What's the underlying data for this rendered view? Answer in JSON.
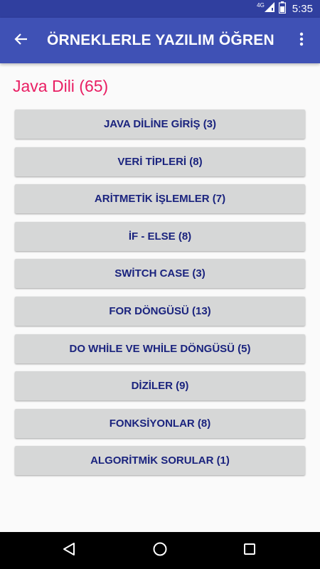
{
  "status_bar": {
    "network_label": "4G",
    "time": "5:35",
    "icons": [
      "signal-icon",
      "battery-icon"
    ]
  },
  "app_bar": {
    "title": "ÖRNEKLERLE YAZILIM ÖĞREN",
    "back_icon": "arrow-back-icon",
    "menu_icon": "more-vert-icon"
  },
  "section": {
    "title": "Java Dili (65)"
  },
  "topics": [
    {
      "label": "JAVA DİLİNE GİRİŞ (3)"
    },
    {
      "label": "VERİ TİPLERİ (8)"
    },
    {
      "label": "ARİTMETİK İŞLEMLER (7)"
    },
    {
      "label": "İF - ELSE (8)"
    },
    {
      "label": "SWİTCH CASE (3)"
    },
    {
      "label": "FOR DÖNGÜSÜ (13)"
    },
    {
      "label": "DO WHİLE VE WHİLE DÖNGÜSÜ (5)"
    },
    {
      "label": "DİZİLER (9)"
    },
    {
      "label": "FONKSİYONLAR (8)"
    },
    {
      "label": "ALGORİTMİK SORULAR (1)"
    }
  ],
  "nav_bar": {
    "icons": [
      "back-triangle-icon",
      "home-circle-icon",
      "recents-square-icon"
    ]
  },
  "colors": {
    "status_bar": "#303f9f",
    "app_bar": "#3f51b5",
    "section_title": "#e91e63",
    "button_bg": "#d6d7d7",
    "button_text": "#1a237e"
  }
}
